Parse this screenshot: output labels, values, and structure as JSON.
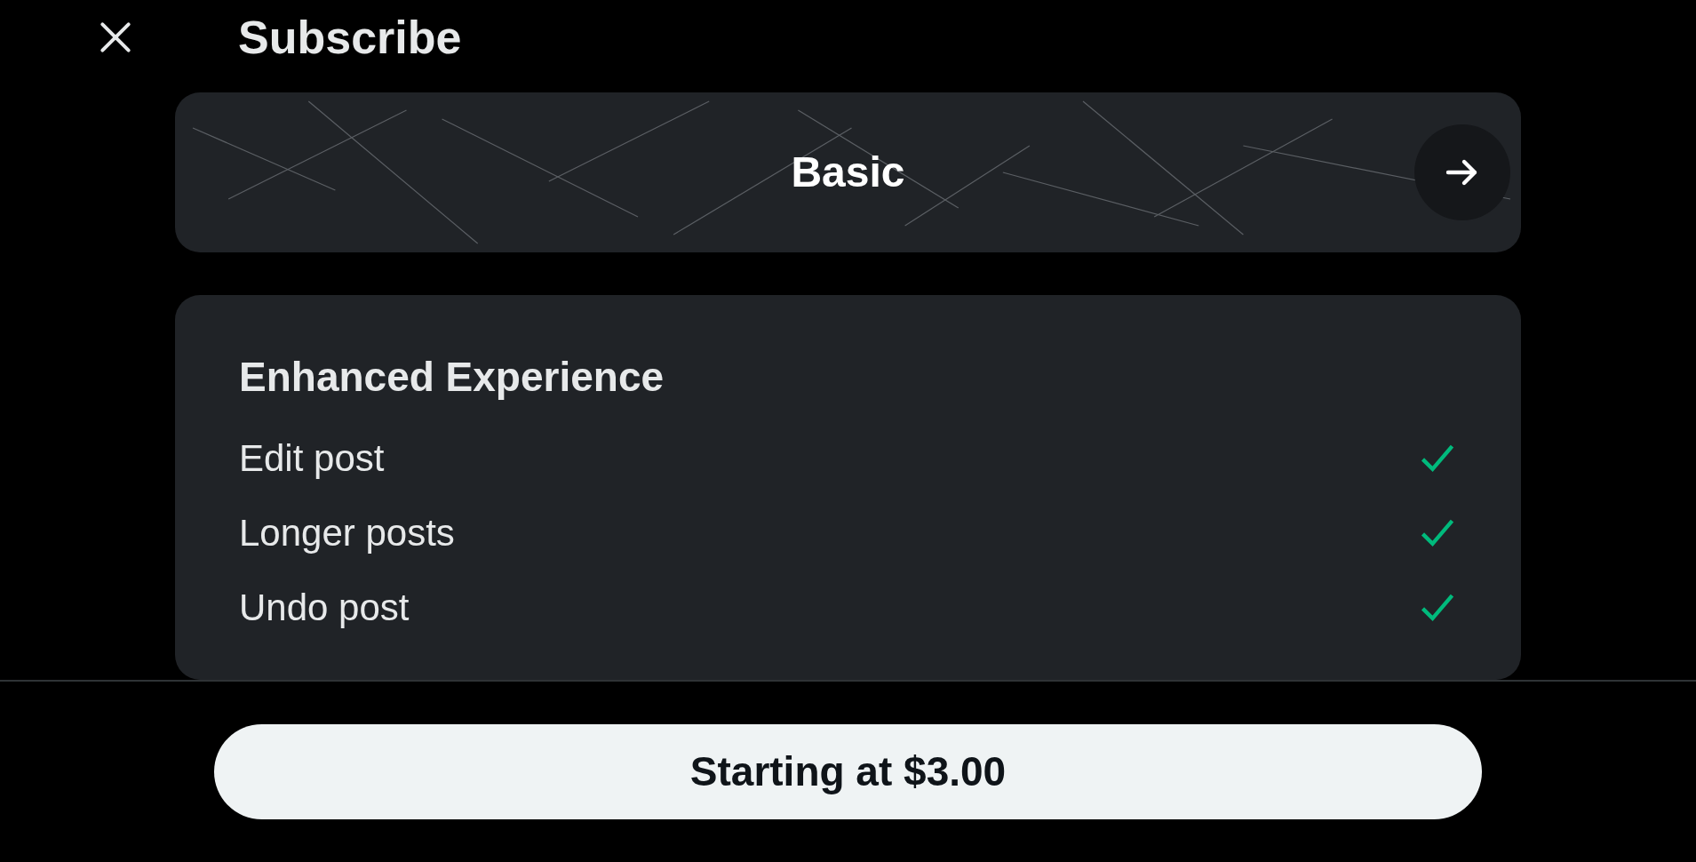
{
  "header": {
    "title": "Subscribe"
  },
  "plan": {
    "name": "Basic"
  },
  "features": {
    "heading": "Enhanced Experience",
    "items": [
      {
        "label": "Edit post",
        "checked": true
      },
      {
        "label": "Longer posts",
        "checked": true
      },
      {
        "label": "Undo post",
        "checked": true
      }
    ]
  },
  "footer": {
    "button": "Starting at $3.00"
  }
}
